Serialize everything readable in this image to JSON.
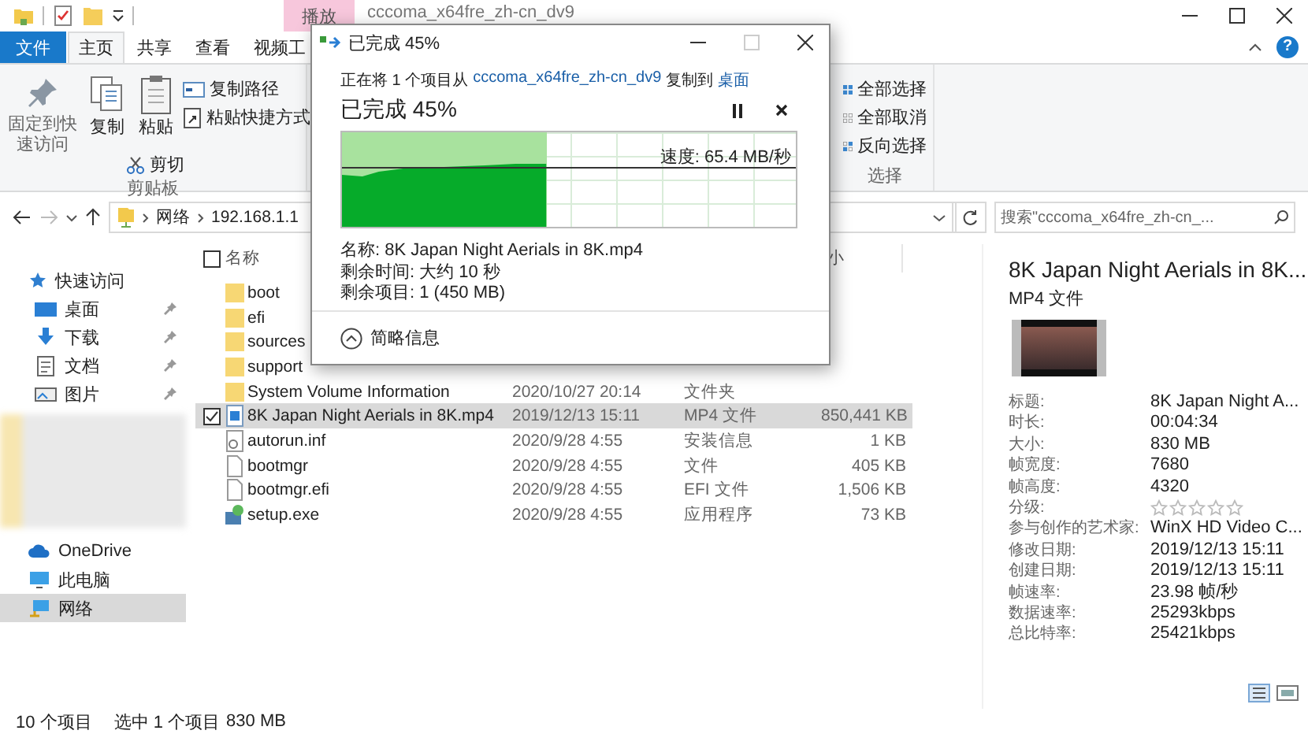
{
  "explorer": {
    "title": "cccoma_x64fre_zh-cn_dv9",
    "context_tab_group": "播放",
    "ribbon_tabs": [
      {
        "label": "文件",
        "kind": "file",
        "selected": false
      },
      {
        "label": "主页",
        "kind": "tab",
        "selected": true
      },
      {
        "label": "共享",
        "kind": "tab",
        "selected": false
      },
      {
        "label": "查看",
        "kind": "tab",
        "selected": false
      },
      {
        "label": "视频工",
        "kind": "tab",
        "selected": false
      }
    ],
    "help_glyph": "?",
    "clipboard_group": {
      "label": "剪贴板",
      "items": [
        {
          "label": "固定到快速访问",
          "kind": "pin"
        },
        {
          "label": "复制",
          "kind": "copy"
        },
        {
          "label": "粘贴",
          "kind": "paste"
        },
        {
          "label": "剪切",
          "kind": "cut"
        },
        {
          "label": "复制路径",
          "kind": "copy-path"
        },
        {
          "label": "粘贴快捷方式",
          "kind": "paste-shortcut"
        }
      ]
    },
    "select_group": {
      "label": "选择",
      "items": [
        {
          "label": "全部选择",
          "kind": "select-all"
        },
        {
          "label": "全部取消",
          "kind": "select-none"
        },
        {
          "label": "反向选择",
          "kind": "invert"
        }
      ]
    },
    "address": {
      "path": [
        "网络",
        "192.168.1.1"
      ],
      "search_placeholder": "搜索\"cccoma_x64fre_zh-cn_..."
    },
    "sidebar": [
      {
        "label": "快速访问",
        "kind": "star",
        "selected": false,
        "children": [
          {
            "label": "桌面",
            "kind": "desktop",
            "pinned": true,
            "selected": false
          },
          {
            "label": "下载",
            "kind": "download",
            "pinned": true,
            "selected": false
          },
          {
            "label": "文档",
            "kind": "document",
            "pinned": true,
            "selected": false
          },
          {
            "label": "图片",
            "kind": "picture",
            "pinned": true,
            "selected": false
          }
        ]
      },
      {
        "label": "OneDrive",
        "kind": "cloud",
        "selected": false
      },
      {
        "label": "此电脑",
        "kind": "pc",
        "selected": false
      },
      {
        "label": "网络",
        "kind": "network",
        "selected": true
      }
    ],
    "table": {
      "header_checked": false,
      "name_header": "名称",
      "column_4_header": "小",
      "rows": [
        {
          "name": "boot",
          "kind": "folder",
          "selected": false
        },
        {
          "name": "efi",
          "kind": "folder",
          "selected": false
        },
        {
          "name": "sources",
          "kind": "folder",
          "selected": false
        },
        {
          "name": "support",
          "kind": "folder",
          "selected": false
        },
        {
          "name": "System Volume Information",
          "date": "2020/10/27 20:14",
          "type": "文件夹",
          "kind": "folder",
          "selected": false
        },
        {
          "name": "8K Japan Night Aerials in 8K.mp4",
          "date": "2019/12/13 15:11",
          "type": "MP4 文件",
          "size": "850,441 KB",
          "kind": "video",
          "selected": true
        },
        {
          "name": "autorun.inf",
          "date": "2020/9/28 4:55",
          "type": "安装信息",
          "size": "1 KB",
          "kind": "settings",
          "selected": false
        },
        {
          "name": "bootmgr",
          "date": "2020/9/28 4:55",
          "type": "文件",
          "size": "405 KB",
          "kind": "file",
          "selected": false
        },
        {
          "name": "bootmgr.efi",
          "date": "2020/9/28 4:55",
          "type": "EFI 文件",
          "size": "1,506 KB",
          "kind": "file",
          "selected": false
        },
        {
          "name": "setup.exe",
          "date": "2020/9/28 4:55",
          "type": "应用程序",
          "size": "73 KB",
          "kind": "app",
          "selected": false
        }
      ]
    },
    "preview": {
      "title": "8K Japan Night Aerials in 8K...",
      "type": "MP4 文件",
      "properties": [
        {
          "label": "标题:",
          "value": "8K Japan Night A...",
          "kind": "text"
        },
        {
          "label": "时长:",
          "value": "00:04:34",
          "kind": "text"
        },
        {
          "label": "大小:",
          "value": "830 MB",
          "kind": "text"
        },
        {
          "label": "帧宽度:",
          "value": "7680",
          "kind": "text"
        },
        {
          "label": "帧高度:",
          "value": "4320",
          "kind": "text"
        },
        {
          "label": "分级:",
          "stars": 0,
          "kind": "rating"
        },
        {
          "label": "参与创作的艺术家:",
          "value": "WinX HD Video C...",
          "kind": "text"
        },
        {
          "label": "修改日期:",
          "value": "2019/12/13 15:11",
          "kind": "text"
        },
        {
          "label": "创建日期:",
          "value": "2019/12/13 15:11",
          "kind": "text"
        },
        {
          "label": "帧速率:",
          "value": "23.98 帧/秒",
          "kind": "text"
        },
        {
          "label": "数据速率:",
          "value": "25293kbps",
          "kind": "text"
        },
        {
          "label": "总比特率:",
          "value": "25421kbps",
          "kind": "text"
        }
      ]
    },
    "status": {
      "count": "10 个项目",
      "selection": "选中 1 个项目",
      "size": "830 MB"
    }
  },
  "copy_dialog": {
    "title": "已完成 45%",
    "message": {
      "prefix": "正在将 1 个项目从",
      "source": "cccoma_x64fre_zh-cn_dv9",
      "middle": "复制到",
      "destination": "桌面"
    },
    "heading": "已完成 45%",
    "progress": {
      "level": 0.45,
      "speed": "速度: 65.4 MB/秒"
    },
    "details": [
      "名称: 8K Japan Night Aerials in 8K.mp4",
      "剩余时间: 大约 10 秒",
      "剩余项目: 1 (450 MB)"
    ],
    "toggle": "简略信息"
  }
}
